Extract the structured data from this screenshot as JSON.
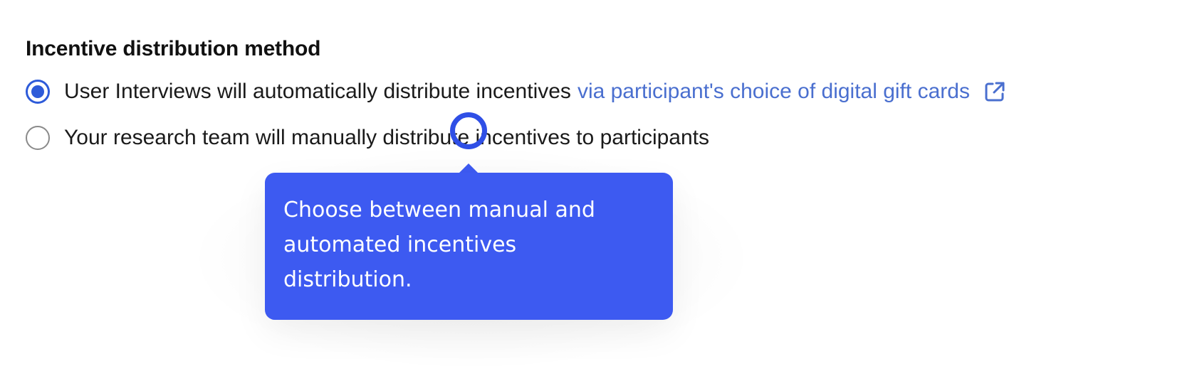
{
  "section": {
    "title": "Incentive distribution method"
  },
  "options": [
    {
      "text": "User Interviews will automatically distribute incentives",
      "link_text": "via participant's choice of digital gift cards",
      "selected": true
    },
    {
      "text": "Your research team will manually distribute incentives to participants",
      "selected": false
    }
  ],
  "tooltip": {
    "text": "Choose between manual and automated incentives distribution."
  },
  "icons": {
    "external_link": "external-link-icon"
  },
  "colors": {
    "accent": "#2e5bd9",
    "link": "#4a6fcf",
    "tooltip_bg": "#3d5af1",
    "cursor_ring": "#2f4fe6"
  }
}
